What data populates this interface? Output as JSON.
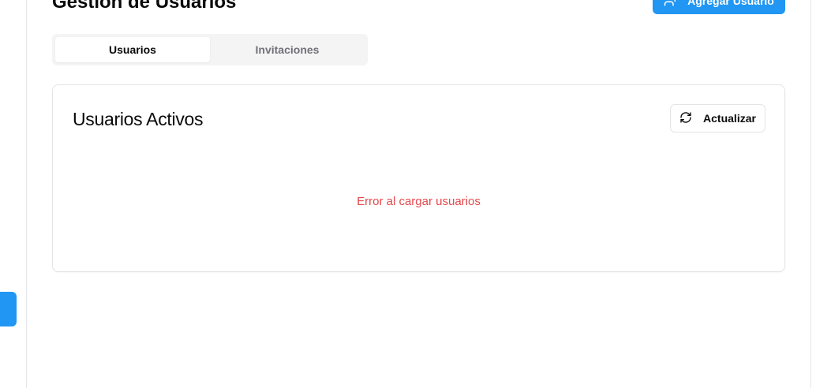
{
  "header": {
    "title": "Gestión de Usuarios",
    "add_user_label": "Agregar Usuario",
    "accent_color": "#2196f3"
  },
  "tabs": [
    {
      "label": "Usuarios",
      "active": true
    },
    {
      "label": "Invitaciones",
      "active": false
    }
  ],
  "card": {
    "title": "Usuarios Activos",
    "refresh_label": "Actualizar",
    "error_message": "Error al cargar usuarios",
    "error_color": "#e5484d"
  },
  "icons": {
    "add_user": "user-plus-icon",
    "refresh": "refresh-icon"
  }
}
